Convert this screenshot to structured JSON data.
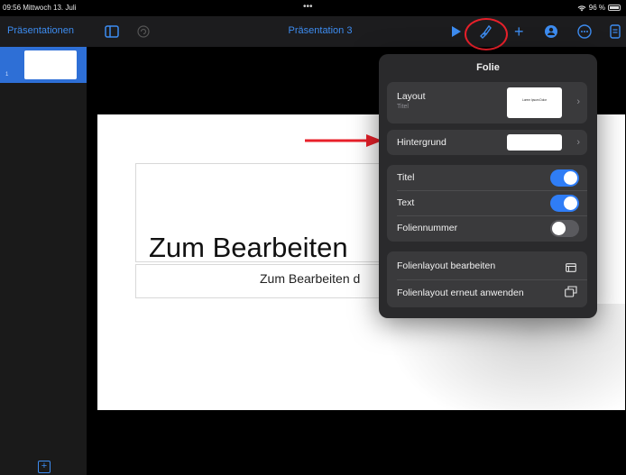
{
  "status_bar": {
    "time": "09:56  Mittwoch 13. Juli",
    "dots": "•••",
    "battery": "96 %"
  },
  "toolbar": {
    "presentations_label": "Präsentationen",
    "document_title": "Präsentation 3",
    "icons": [
      "sidebar-toggle",
      "undo",
      "play",
      "format-brush",
      "add",
      "collaborate",
      "more",
      "document"
    ],
    "accent_color": "#3d8cf0"
  },
  "sidebar": {
    "slide_number": "1",
    "selected_color": "#2e6fd6"
  },
  "slide": {
    "title": "Zum Bearbeiten",
    "body": "Zum Bearbeiten d"
  },
  "popover": {
    "title": "Folie",
    "layout": {
      "label": "Layout",
      "sublabel": "Titel",
      "thumb_text": "Lorem Ipsum Dolor"
    },
    "background_label": "Hintergrund",
    "toggles": [
      {
        "label": "Titel",
        "on": true
      },
      {
        "label": "Text",
        "on": true
      },
      {
        "label": "Foliennummer",
        "on": false
      }
    ],
    "actions": [
      {
        "label": "Folienlayout bearbeiten",
        "icon": "layout-edit-icon"
      },
      {
        "label": "Folienlayout erneut anwenden",
        "icon": "reapply-layout-icon"
      }
    ],
    "toggle_on_color": "#2f7df6"
  },
  "annotations": {
    "highlight_color": "#e8202a"
  }
}
